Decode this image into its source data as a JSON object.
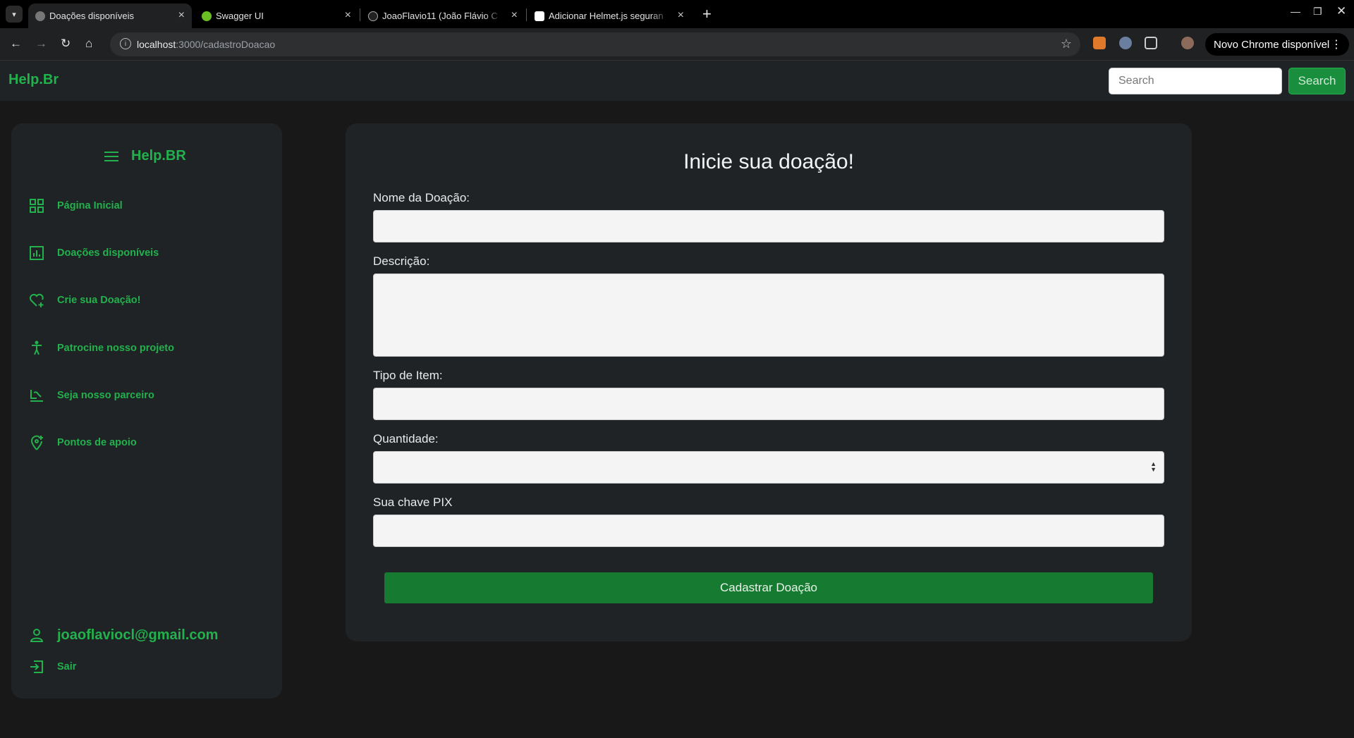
{
  "browser": {
    "tabs": [
      {
        "title": "Doações disponíveis",
        "active": true
      },
      {
        "title": "Swagger UI",
        "active": false
      },
      {
        "title": "JoaoFlavio11 (João Flávio C",
        "active": false
      },
      {
        "title": "Adicionar Helmet.js seguran",
        "active": false
      }
    ],
    "url_host": "localhost",
    "url_path": ":3000/cadastroDoacao",
    "update_label": "Novo Chrome disponível"
  },
  "navbar": {
    "brand": "Help.Br",
    "search_placeholder": "Search",
    "search_button": "Search"
  },
  "sidebar": {
    "brand": "Help.BR",
    "items": [
      {
        "label": "Página Inicial",
        "icon": "grid-icon"
      },
      {
        "label": "Doações disponíveis",
        "icon": "chart-icon"
      },
      {
        "label": "Crie sua Doação!",
        "icon": "heart-plus-icon"
      },
      {
        "label": "Patrocine nosso projeto",
        "icon": "accessibility-icon"
      },
      {
        "label": "Seja nosso parceiro",
        "icon": "handshake-icon"
      },
      {
        "label": "Pontos de apoio",
        "icon": "location-plus-icon"
      }
    ],
    "user_email": "joaoflaviocl@gmail.com",
    "logout_label": "Sair"
  },
  "form": {
    "title": "Inicie sua doação!",
    "fields": {
      "nome_label": "Nome da Doação:",
      "descricao_label": "Descrição:",
      "tipo_label": "Tipo de Item:",
      "quantidade_label": "Quantidade:",
      "pix_label": "Sua chave PIX"
    },
    "submit_label": "Cadastrar Doação"
  },
  "colors": {
    "accent": "#22b14c",
    "button": "#167a30",
    "background": "#181818",
    "panel": "#1f2326"
  }
}
